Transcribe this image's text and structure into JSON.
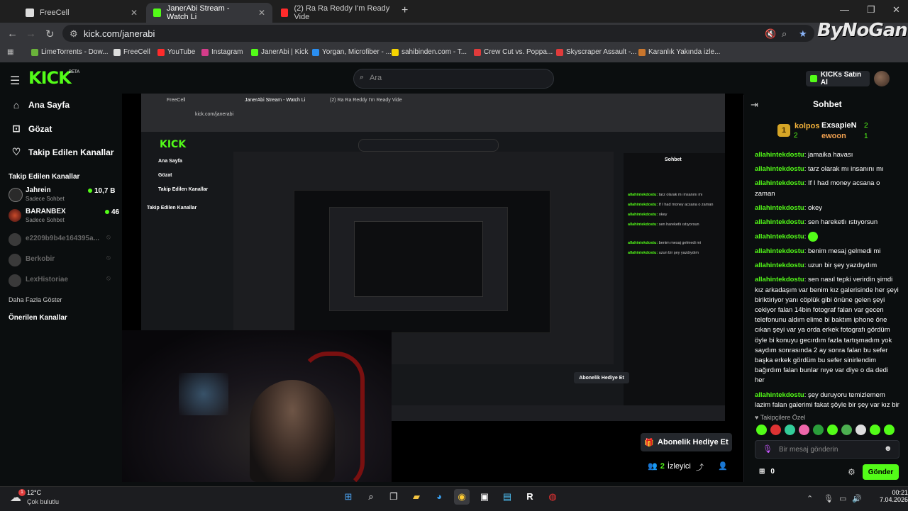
{
  "browser": {
    "tabs": [
      {
        "label": "FreeCell",
        "color": "#cfcfcf"
      },
      {
        "label": "JanerAbi Stream - Watch Li",
        "color": "#53fc18"
      },
      {
        "label": "(2) Ra Ra Reddy I'm Ready Vide",
        "color": "#ff2b2b"
      }
    ],
    "url": "kick.com/janerabi",
    "watermark": "ByNoGan"
  },
  "bookmarks": [
    {
      "label": "LimeTorrents - Dow...",
      "color": "#6ab23a"
    },
    {
      "label": "FreeCell",
      "color": "#dddddd"
    },
    {
      "label": "YouTube",
      "color": "#ff2b2b"
    },
    {
      "label": "Instagram",
      "color": "#d43c8a"
    },
    {
      "label": "JanerAbi | Kick",
      "color": "#53fc18"
    },
    {
      "label": "Yorgan, Microfiber - ...",
      "color": "#2a8ef0"
    },
    {
      "label": "sahibinden.com - T...",
      "color": "#f5d400"
    },
    {
      "label": "Crew Cut vs. Poppa...",
      "color": "#e03b3b"
    },
    {
      "label": "Skyscraper Assault -...",
      "color": "#e03b3b"
    },
    {
      "label": "Karanlık Yakında izle...",
      "color": "#c9762d"
    }
  ],
  "kick": {
    "logo": "KICK",
    "beta": "BETA",
    "search_placeholder": "Ara",
    "kicks_button": "KICKs Satın Al"
  },
  "sidebar": {
    "nav": [
      {
        "label": "Ana Sayfa",
        "icon": "⌂"
      },
      {
        "label": "Gözat",
        "icon": "⊡"
      },
      {
        "label": "Takip Edilen Kanallar",
        "icon": "♡"
      }
    ],
    "followed_heading": "Takip Edilen Kanallar",
    "channels": [
      {
        "name": "Jahrein",
        "sub": "Sadece Sohbet",
        "viewers": "10,7 B",
        "online": true
      },
      {
        "name": "BARANBEX",
        "sub": "Sadece Sohbet",
        "viewers": "46",
        "online": true
      },
      {
        "name": "e2209b9b4e164395a...",
        "sub": "",
        "viewers": "",
        "online": false
      },
      {
        "name": "Berkobir",
        "sub": "",
        "viewers": "",
        "online": false
      },
      {
        "name": "LexHistoriae",
        "sub": "",
        "viewers": "",
        "online": false
      }
    ],
    "show_more": "Daha Fazla Göster",
    "suggested_heading": "Önerilen Kanallar"
  },
  "stream": {
    "gift_button": "Abonelik Hediye Et",
    "viewers_count": "2",
    "viewers_label": "İzleyici"
  },
  "chat": {
    "title": "Sohbet",
    "gifters": {
      "top": "kolpos",
      "top_count": "2",
      "second": "ExsapieN",
      "second_count": "2",
      "third": "ewoon",
      "third_count": "1"
    },
    "messages": [
      {
        "user": "allahintekdostu",
        "text": "jamaika havası"
      },
      {
        "user": "allahintekdostu",
        "text": "tarz olarak mı insanını mı"
      },
      {
        "user": "allahintekdostu",
        "text": "If I had money acsana o zaman"
      },
      {
        "user": "allahintekdostu",
        "text": "okey"
      },
      {
        "user": "allahintekdostu",
        "text": "sen hareketlı ıstıyorsun"
      },
      {
        "user": "allahintekdostu",
        "text": "",
        "emote": true
      },
      {
        "user": "allahintekdostu",
        "text": "benim mesaj gelmedi mi"
      },
      {
        "user": "allahintekdostu",
        "text": "uzun bir şey yazdıydım"
      },
      {
        "user": "allahintekdostu",
        "text": "sen nasıl tepki verirdin şimdi kız arkadaşım var benim kız galerisinde her şeyi biriktiriyor yanı cöplük gibi önüne gelen şeyi cekiyor falan 14bin fotograf falan var gecen telefonunu aldım elime bi baktım iphone öne cıkan şeyi var ya orda erkek fotografı gördüm öyle bi konuyu gecırdım fazla tartışmadım yok saydım sonrasında 2 ay sonra falan bu sefer başka erkek gördüm bu sefer sinirlendim bağırdım falan bunlar nıye var diye o da dedi her"
      },
      {
        "user": "allahintekdostu",
        "text": "şey duruyoru temizlemem lazim falan galerimi fakat şöyle bir şey var kız bir panik yaptı hissettim yani o telefonu böyle elinden alınca"
      }
    ],
    "subscribers_label": "Takipçilere Özel",
    "input_placeholder": "Bir mesaj gönderin",
    "gift_count": "0",
    "send_button": "Gönder"
  },
  "taskbar": {
    "temp": "12°C",
    "condition": "Çok bulutlu",
    "badge": "1",
    "time": "00:21",
    "date": "7.04.2026"
  }
}
